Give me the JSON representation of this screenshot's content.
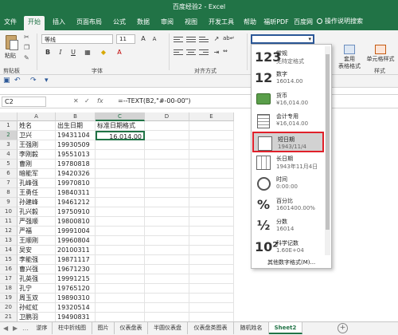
{
  "window": {
    "title": "百度经验2  -  Excel"
  },
  "tabs": [
    "文件",
    "开始",
    "插入",
    "页面布局",
    "公式",
    "数据",
    "审阅",
    "视图",
    "开发工具",
    "帮助",
    "福昕PDF",
    "百度网盘"
  ],
  "active_tab": "开始",
  "tell_me": "操作说明搜索",
  "ribbon": {
    "paste_label": "粘贴",
    "clipboard_label": "剪贴板",
    "font_name": "等线",
    "font_size": "11",
    "font_group_label": "字体",
    "align_group_label": "对齐方式",
    "bold": "B",
    "italic": "I",
    "underline": "U",
    "cond_format_label": "条件格式",
    "table_format_label": "套用\n表格格式",
    "cell_style_label": "单元格样式",
    "styles_group_label": "样式"
  },
  "formula_bar": {
    "name_box": "C2",
    "cancel": "✕",
    "confirm": "✓",
    "fx": "fx",
    "formula": "=--TEXT(B2,\"#-00-00\")"
  },
  "grid": {
    "columns": [
      "A",
      "B",
      "C",
      "D",
      "E"
    ],
    "selected_column": "C",
    "selected_row": "2",
    "headers_row": [
      "姓名",
      "出生日期",
      "标准日期格式"
    ],
    "rows": [
      [
        "卫兴",
        "19431104",
        "16,014.00"
      ],
      [
        "王强刚",
        "19930509",
        ""
      ],
      [
        "李刚毅",
        "19551013",
        ""
      ],
      [
        "曹刚",
        "19780818",
        ""
      ],
      [
        "暗能军",
        "19420326",
        ""
      ],
      [
        "孔峰强",
        "19970810",
        ""
      ],
      [
        "王勇任",
        "19840311",
        ""
      ],
      [
        "孙建峰",
        "19461212",
        ""
      ],
      [
        "孔兴毅",
        "19750910",
        ""
      ],
      [
        "严强顺",
        "19800810",
        ""
      ],
      [
        "严福",
        "19991004",
        ""
      ],
      [
        "王顺刚",
        "19960804",
        ""
      ],
      [
        "吴安",
        "20100311",
        ""
      ],
      [
        "李能强",
        "19871117",
        ""
      ],
      [
        "曹兴强",
        "19671230",
        ""
      ],
      [
        "孔英强",
        "19991215",
        ""
      ],
      [
        "孔宁",
        "19765120",
        ""
      ],
      [
        "周玉双",
        "19890310",
        ""
      ],
      [
        "孙虹虹",
        "19320514",
        ""
      ],
      [
        "卫鹏羽",
        "19490831",
        ""
      ],
      [
        "郑秀秀",
        "19400802",
        ""
      ]
    ]
  },
  "sheet_tabs": [
    "逆序",
    "柱中折线图",
    "图片",
    "仪表盘表",
    "半圆仪表盘",
    "仪表盘类图表",
    "随机姓名",
    "Sheet2"
  ],
  "active_sheet": "Sheet2",
  "number_format_menu": {
    "items": [
      {
        "icon": "123",
        "title": "常规",
        "sub": "无特定格式"
      },
      {
        "icon": "12",
        "title": "数字",
        "sub": "16014.00"
      },
      {
        "icon": "currency",
        "title": "货币",
        "sub": "¥16,014.00"
      },
      {
        "icon": "accounting",
        "title": "会计专用",
        "sub": "¥16,014.00"
      },
      {
        "icon": "calendar",
        "title": "短日期",
        "sub": "1943/11/4"
      },
      {
        "icon": "calendar",
        "title": "长日期",
        "sub": "1943年11月4日"
      },
      {
        "icon": "clock",
        "title": "时间",
        "sub": "0:00:00"
      },
      {
        "icon": "%",
        "title": "百分比",
        "sub": "1601400.00%"
      },
      {
        "icon": "½",
        "title": "分数",
        "sub": "16014"
      },
      {
        "icon": "10²",
        "title": "科学记数",
        "sub": "1.60E+04"
      }
    ],
    "highlighted": "短日期",
    "more_label": "其他数字格式(M)..."
  }
}
